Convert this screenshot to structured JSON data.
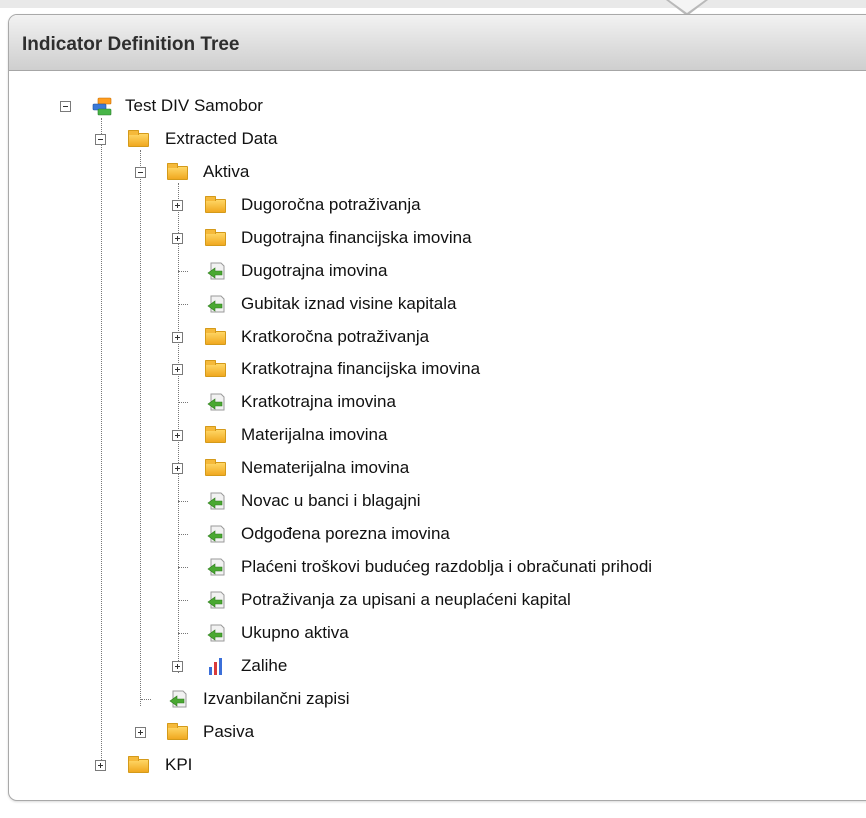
{
  "panel": {
    "title": "Indicator Definition Tree"
  },
  "tree": [
    {
      "label": "Test DIV Samobor",
      "icon": "database-icon",
      "toggle": "minus"
    },
    {
      "label": "Extracted Data",
      "icon": "folder-icon",
      "toggle": "minus"
    },
    {
      "label": "Aktiva",
      "icon": "folder-icon",
      "toggle": "minus"
    },
    {
      "label": "Dugoročna potraživanja",
      "icon": "folder-icon",
      "toggle": "plus"
    },
    {
      "label": "Dugotrajna financijska imovina",
      "icon": "folder-icon",
      "toggle": "plus"
    },
    {
      "label": "Dugotrajna imovina",
      "icon": "indicator-arrow-icon",
      "toggle": "none"
    },
    {
      "label": "Gubitak iznad visine kapitala",
      "icon": "indicator-arrow-icon",
      "toggle": "none"
    },
    {
      "label": "Kratkoročna potraživanja",
      "icon": "folder-icon",
      "toggle": "plus"
    },
    {
      "label": "Kratkotrajna financijska imovina",
      "icon": "folder-icon",
      "toggle": "plus"
    },
    {
      "label": "Kratkotrajna imovina",
      "icon": "indicator-arrow-icon",
      "toggle": "none"
    },
    {
      "label": "Materijalna imovina",
      "icon": "folder-icon",
      "toggle": "plus"
    },
    {
      "label": "Nematerijalna imovina",
      "icon": "folder-icon",
      "toggle": "plus"
    },
    {
      "label": "Novac u banci i blagajni",
      "icon": "indicator-arrow-icon",
      "toggle": "none"
    },
    {
      "label": "Odgođena porezna imovina",
      "icon": "indicator-arrow-icon",
      "toggle": "none"
    },
    {
      "label": "Plaćeni troškovi budućeg razdoblja i obračunati prihodi",
      "icon": "indicator-arrow-icon",
      "toggle": "none"
    },
    {
      "label": "Potraživanja za upisani a neuplaćeni kapital",
      "icon": "indicator-arrow-icon",
      "toggle": "none"
    },
    {
      "label": "Ukupno aktiva",
      "icon": "indicator-arrow-icon",
      "toggle": "none"
    },
    {
      "label": "Zalihe",
      "icon": "bar-chart-icon",
      "toggle": "plus"
    },
    {
      "label": "Izvanbilančni zapisi",
      "icon": "indicator-arrow-icon",
      "toggle": "none"
    },
    {
      "label": "Pasiva",
      "icon": "folder-icon",
      "toggle": "plus"
    },
    {
      "label": "KPI",
      "icon": "folder-icon",
      "toggle": "plus"
    }
  ]
}
